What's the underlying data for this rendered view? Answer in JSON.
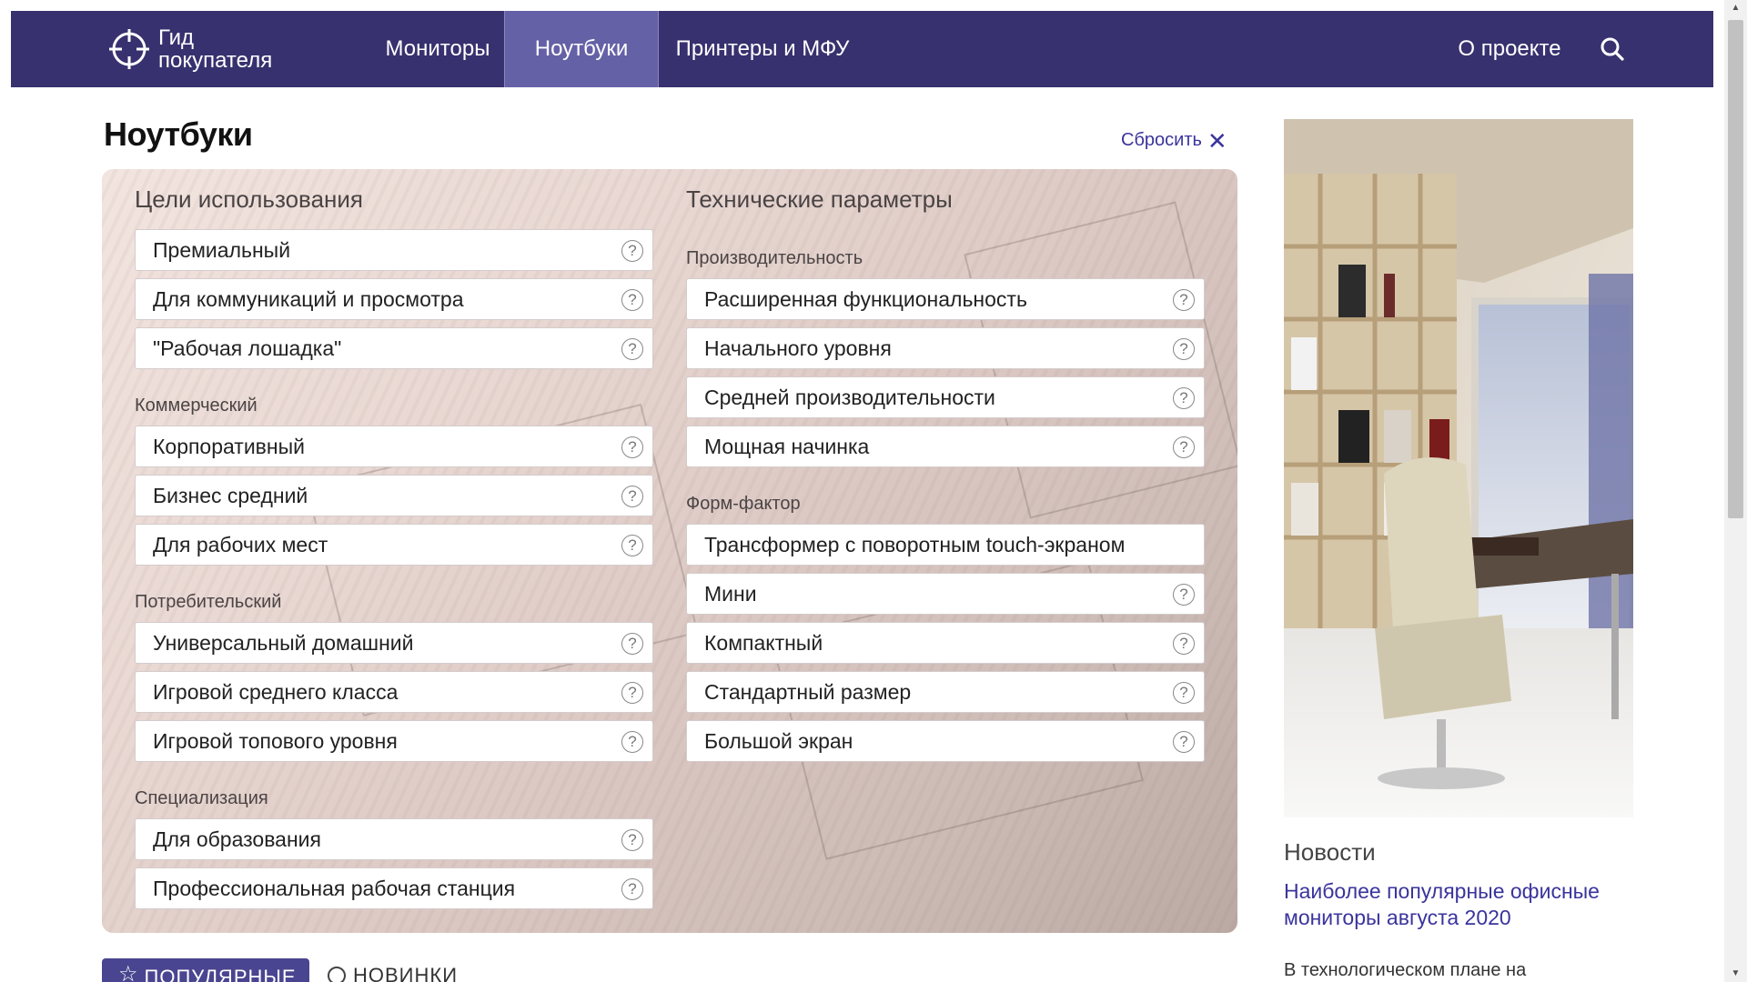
{
  "header": {
    "logo_line1": "Гид",
    "logo_line2": "покупателя",
    "nav": {
      "monitors": "Мониторы",
      "notebooks": "Ноутбуки",
      "printers": "Принтеры и МФУ",
      "about": "О проекте"
    },
    "active_item": "Ноутбуки",
    "search_icon": "search-icon"
  },
  "page": {
    "title": "Ноутбуки",
    "reset_label": "Сбросить"
  },
  "filters": {
    "purpose": {
      "title": "Цели использования",
      "general": [
        "Премиальный",
        "Для коммуникаций и просмотра",
        "\"Рабочая лошадка\""
      ],
      "commercial_label": "Коммерческий",
      "commercial": [
        "Корпоративный",
        "Бизнес средний",
        "Для рабочих мест"
      ],
      "consumer_label": "Потребительский",
      "consumer": [
        "Универсальный домашний",
        "Игровой среднего класса",
        "Игровой топового уровня"
      ],
      "special_label": "Специализация",
      "special": [
        "Для образования",
        "Профессиональная рабочая станция"
      ]
    },
    "tech": {
      "title": "Технические параметры",
      "performance_label": "Производительность",
      "performance": [
        "Расширенная функциональность",
        "Начального уровня",
        "Средней производительности",
        "Мощная начинка"
      ],
      "form_label": "Форм-фактор",
      "form": [
        "Трансформер с поворотным touch-экраном",
        "Мини",
        "Компактный",
        "Стандартный размер",
        "Большой экран"
      ]
    },
    "help_glyph": "?"
  },
  "sort_tabs": {
    "popular": "ПОПУЛЯРНЫЕ",
    "new": "НОВИНКИ"
  },
  "sidebar": {
    "news_title": "Новости",
    "news_link": "Наиболее популярные офисные мониторы августа 2020",
    "news_teaser": "В технологическом плане на"
  },
  "colors": {
    "nav_bg": "#37316f",
    "nav_active": "#6561a6",
    "link": "#3a349c",
    "button": "#4a4590"
  }
}
